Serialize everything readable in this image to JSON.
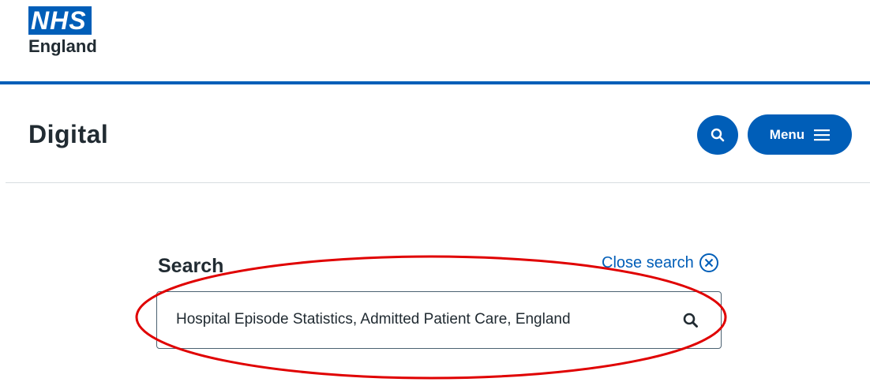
{
  "header": {
    "logo": {
      "brand": "NHS",
      "organisation": "England"
    },
    "site_title": "Digital",
    "search_toggle_icon": "search-icon",
    "menu": {
      "label": "Menu",
      "icon": "hamburger-icon"
    }
  },
  "search": {
    "heading": "Search",
    "close_label": "Close search",
    "close_icon": "close-circle-icon",
    "input_value": "Hospital Episode Statistics, Admitted Patient Care, England",
    "submit_icon": "search-icon"
  },
  "colors": {
    "brand_blue": "#005eb8",
    "text": "#212b32",
    "annotation_red": "#e00000"
  }
}
